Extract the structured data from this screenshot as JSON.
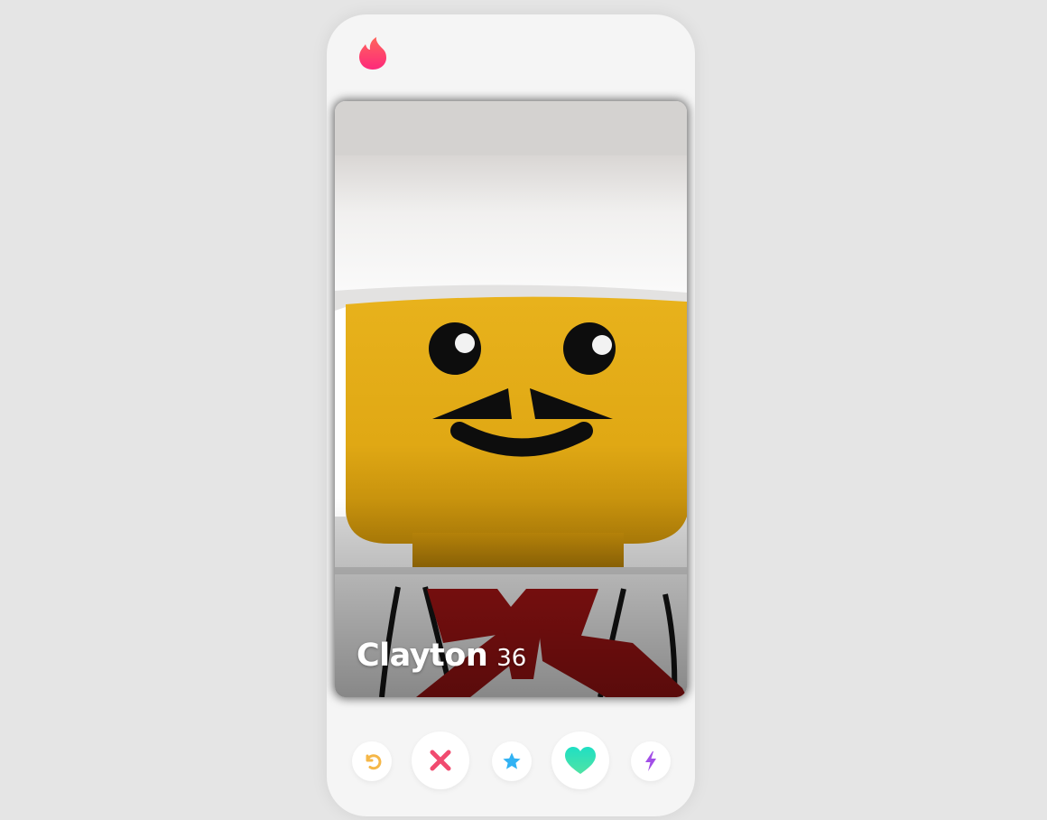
{
  "app": {
    "logo_icon": "flame-icon",
    "brand_colors": [
      "#fd297b",
      "#ff655b"
    ]
  },
  "profile": {
    "name": "Clayton",
    "age": "36",
    "photo": "lego-chef-minifigure-face"
  },
  "actions": [
    {
      "name": "rewind-button",
      "icon": "rewind-icon",
      "color": "#f5b748"
    },
    {
      "name": "nope-button",
      "icon": "close-icon",
      "color": "#f14b6f"
    },
    {
      "name": "super-like-button",
      "icon": "star-icon",
      "color": "#31b2f3"
    },
    {
      "name": "like-button",
      "icon": "heart-icon",
      "color": "#2ce0b5"
    },
    {
      "name": "boost-button",
      "icon": "lightning-icon",
      "color": "#a24fe7"
    }
  ]
}
